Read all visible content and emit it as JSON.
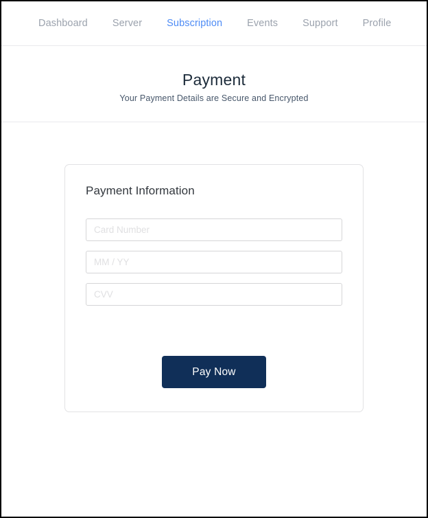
{
  "nav": {
    "items": [
      {
        "label": "Dashboard",
        "active": false
      },
      {
        "label": "Server",
        "active": false
      },
      {
        "label": "Subscription",
        "active": true
      },
      {
        "label": "Events",
        "active": false
      },
      {
        "label": "Support",
        "active": false
      },
      {
        "label": "Profile",
        "active": false
      }
    ],
    "active_color": "#4d8bf5",
    "inactive_color": "#9ba2ad"
  },
  "header": {
    "title": "Payment",
    "subtitle": "Your Payment Details are Secure and Encrypted"
  },
  "payment_card": {
    "heading": "Payment Information",
    "fields": [
      {
        "name": "card-number",
        "placeholder": "Card Number",
        "value": ""
      },
      {
        "name": "expiry",
        "placeholder": "MM / YY",
        "value": ""
      },
      {
        "name": "cvv",
        "placeholder": "CVV",
        "value": ""
      }
    ],
    "submit_label": "Pay Now",
    "submit_color": "#102f58"
  }
}
